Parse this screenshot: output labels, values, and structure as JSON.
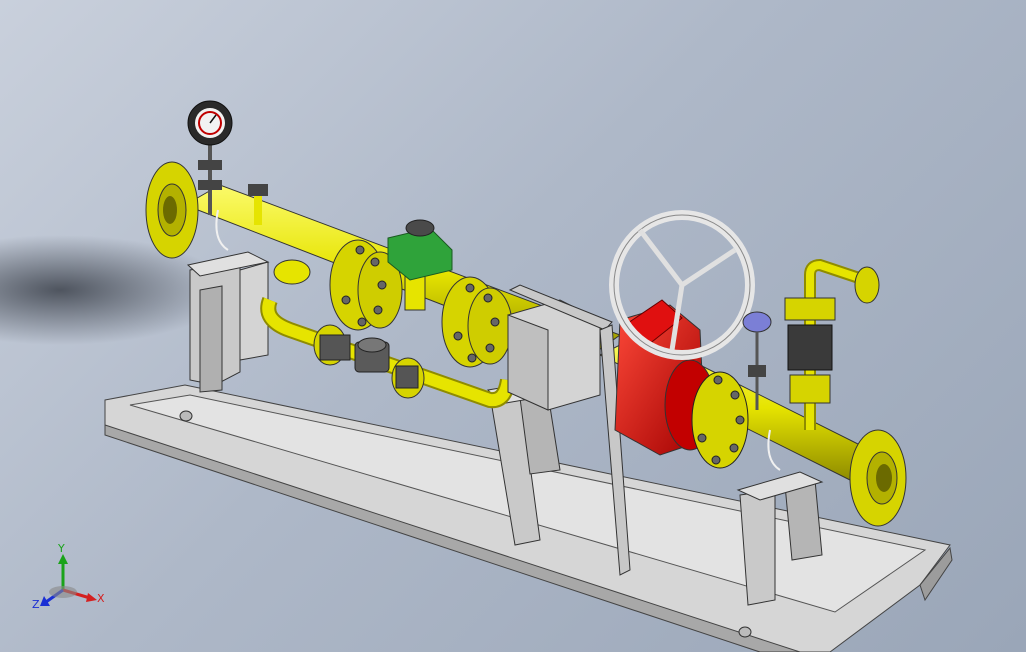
{
  "triad": {
    "x_label": "X",
    "y_label": "Y",
    "z_label": "Z",
    "x_color": "#d42020",
    "y_color": "#1aa31a",
    "z_color": "#1a2fd4"
  },
  "colors": {
    "pipe": "#e6e400",
    "valve_body": "#e01010",
    "actuator": "#2fa33a",
    "frame": "#c8c8c8",
    "base": "#d9d9d9",
    "handwheel": "#e6e6e6",
    "gauge": "#2a2a2a",
    "regulator": "#7b7fd6",
    "bolts": "#6a6a6a"
  },
  "icons": {
    "triad": "coordinate-triad-icon"
  }
}
